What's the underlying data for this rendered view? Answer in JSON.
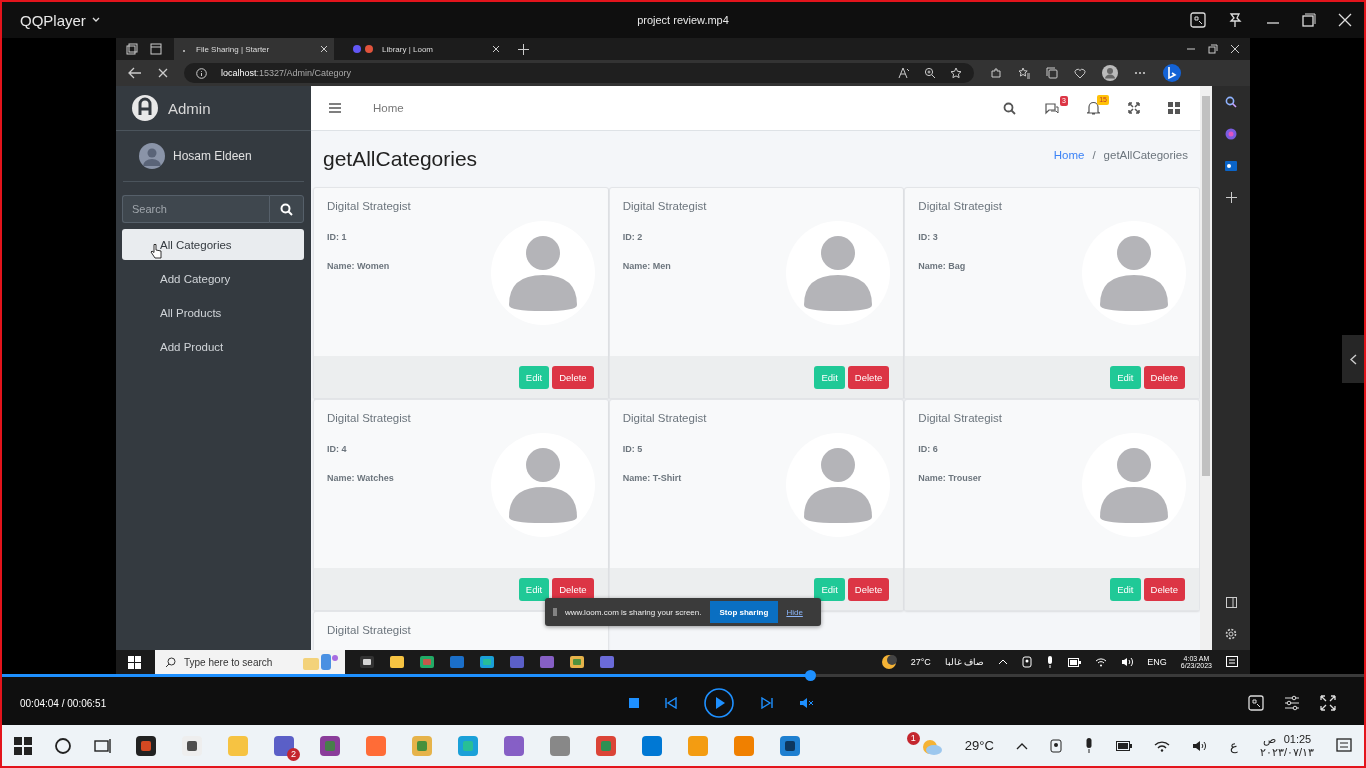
{
  "player": {
    "app_name": "QQPlayer",
    "file_title": "project review.mp4",
    "time": "00:04:04 / 00:06:51",
    "progress": {
      "level": 0.594
    }
  },
  "browser": {
    "tabs": [
      {
        "label": "File Sharing | Starter",
        "selected": true
      },
      {
        "label": "Library | Loom",
        "selected": false
      }
    ],
    "address": "**localhost**:15327/Admin/Category"
  },
  "sidebar": {
    "brand": "Admin",
    "user": "Hosam Eldeen",
    "search": {
      "placeholder": "Search"
    },
    "items": [
      {
        "label": "All Categories",
        "selected": true
      },
      {
        "label": "Add Category",
        "selected": false
      },
      {
        "label": "All Products",
        "selected": false
      },
      {
        "label": "Add Product",
        "selected": false
      }
    ]
  },
  "topbar": {
    "home_link": "Home",
    "messages_badge": "3",
    "notifications_badge": "15"
  },
  "page": {
    "title": "getAllCategories",
    "breadcrumb": [
      "Home",
      "getAllCategories"
    ],
    "breadcrumb_separator": "/"
  },
  "cards": [
    {
      "title": "Digital Strategist",
      "id": "ID: 1",
      "name": "Name: Women",
      "buttons": [
        "Edit",
        "Delete"
      ]
    },
    {
      "title": "Digital Strategist",
      "id": "ID: 2",
      "name": "Name: Men",
      "buttons": [
        "Edit",
        "Delete"
      ]
    },
    {
      "title": "Digital Strategist",
      "id": "ID: 3",
      "name": "Name: Bag",
      "buttons": [
        "Edit",
        "Delete"
      ]
    },
    {
      "title": "Digital Strategist",
      "id": "ID: 4",
      "name": "Name: Watches",
      "buttons": [
        "Edit",
        "Delete"
      ]
    },
    {
      "title": "Digital Strategist",
      "id": "ID: 5",
      "name": "Name: T-Shirt",
      "buttons": [
        "Edit",
        "Delete"
      ]
    },
    {
      "title": "Digital Strategist",
      "id": "ID: 6",
      "name": "Name: Trouser",
      "buttons": [
        "Edit",
        "Delete"
      ]
    },
    {
      "title": "Digital Strategist"
    }
  ],
  "loom_bar": {
    "message": "www.loom.com is sharing your screen.",
    "stop_button": "Stop sharing",
    "hide_link": "Hide"
  },
  "inner_taskbar": {
    "search_placeholder": "Type here to search",
    "temperature": "27°C",
    "weather_text": "صاف غالبا",
    "language": "ENG",
    "time": "4:03 AM",
    "date": "6/23/2023"
  },
  "outer_taskbar": {
    "teams_badge": "2",
    "weather_badge": "1",
    "temperature": "29°C",
    "language": "ع",
    "time": "01:25",
    "period": "ص",
    "date": "٢٠٢٣/٠٧/١٣"
  }
}
